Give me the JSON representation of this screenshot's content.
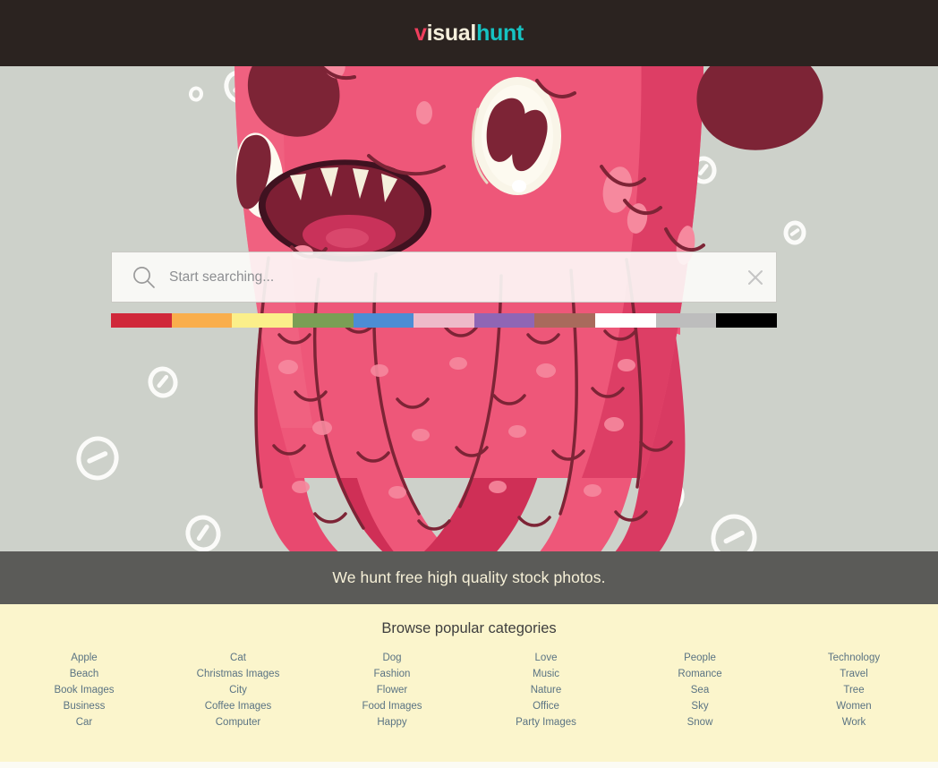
{
  "header": {
    "logo": {
      "part1": "v",
      "part2": "isual",
      "part3": "hunt",
      "color1": "#ef3e5c",
      "color2": "#f5efdc",
      "color3": "#16c2c2"
    },
    "background_color": "#2b2320"
  },
  "hero": {
    "background_color": "#cdd1ca",
    "illustration_alt": "pink octopus monster mascot"
  },
  "search": {
    "placeholder": "Start searching...",
    "value": "",
    "search_icon": "search-icon",
    "clear_icon": "close-icon"
  },
  "color_filters": [
    {
      "name": "red",
      "hex": "#d0283a"
    },
    {
      "name": "orange",
      "hex": "#f9ae4c"
    },
    {
      "name": "yellow",
      "hex": "#fbef8a"
    },
    {
      "name": "green",
      "hex": "#7a9f55"
    },
    {
      "name": "blue",
      "hex": "#4c8dd4"
    },
    {
      "name": "pink",
      "hex": "#eebac9"
    },
    {
      "name": "purple",
      "hex": "#8f66b5"
    },
    {
      "name": "brown",
      "hex": "#a96a5c"
    },
    {
      "name": "white",
      "hex": "#ffffff"
    },
    {
      "name": "gray",
      "hex": "#bdbdbd"
    },
    {
      "name": "black",
      "hex": "#000000"
    }
  ],
  "tagline": {
    "text": "We hunt free high quality stock photos.",
    "text_color": "#f7f1d8",
    "bar_color": "#2e2e2c"
  },
  "categories": {
    "title": "Browse popular categories",
    "background_color": "#fbf5cc",
    "link_color": "#5a7383",
    "columns": [
      {
        "items": [
          "Apple",
          "Beach",
          "Book Images",
          "Business",
          "Car"
        ]
      },
      {
        "items": [
          "Cat",
          "Christmas Images",
          "City",
          "Coffee Images",
          "Computer"
        ]
      },
      {
        "items": [
          "Dog",
          "Fashion",
          "Flower",
          "Food Images",
          "Happy"
        ]
      },
      {
        "items": [
          "Love",
          "Music",
          "Nature",
          "Office",
          "Party Images"
        ]
      },
      {
        "items": [
          "People",
          "Romance",
          "Sea",
          "Sky",
          "Snow"
        ]
      },
      {
        "items": [
          "Technology",
          "Travel",
          "Tree",
          "Women",
          "Work"
        ]
      }
    ]
  }
}
